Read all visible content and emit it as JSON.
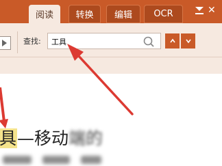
{
  "tabs": [
    {
      "label": "阅读",
      "active": true
    },
    {
      "label": "转换",
      "active": false
    },
    {
      "label": "编辑",
      "active": false
    },
    {
      "label": "OCR",
      "active": false
    }
  ],
  "search": {
    "label": "查找:",
    "value": "工具"
  },
  "document": {
    "highlight": "具",
    "text": "—移动",
    "blurred": "端的"
  },
  "colors": {
    "accent": "#c95a28",
    "panel": "#f6e9e0",
    "arrow": "#dc3a32",
    "highlight": "#f4e38c"
  }
}
